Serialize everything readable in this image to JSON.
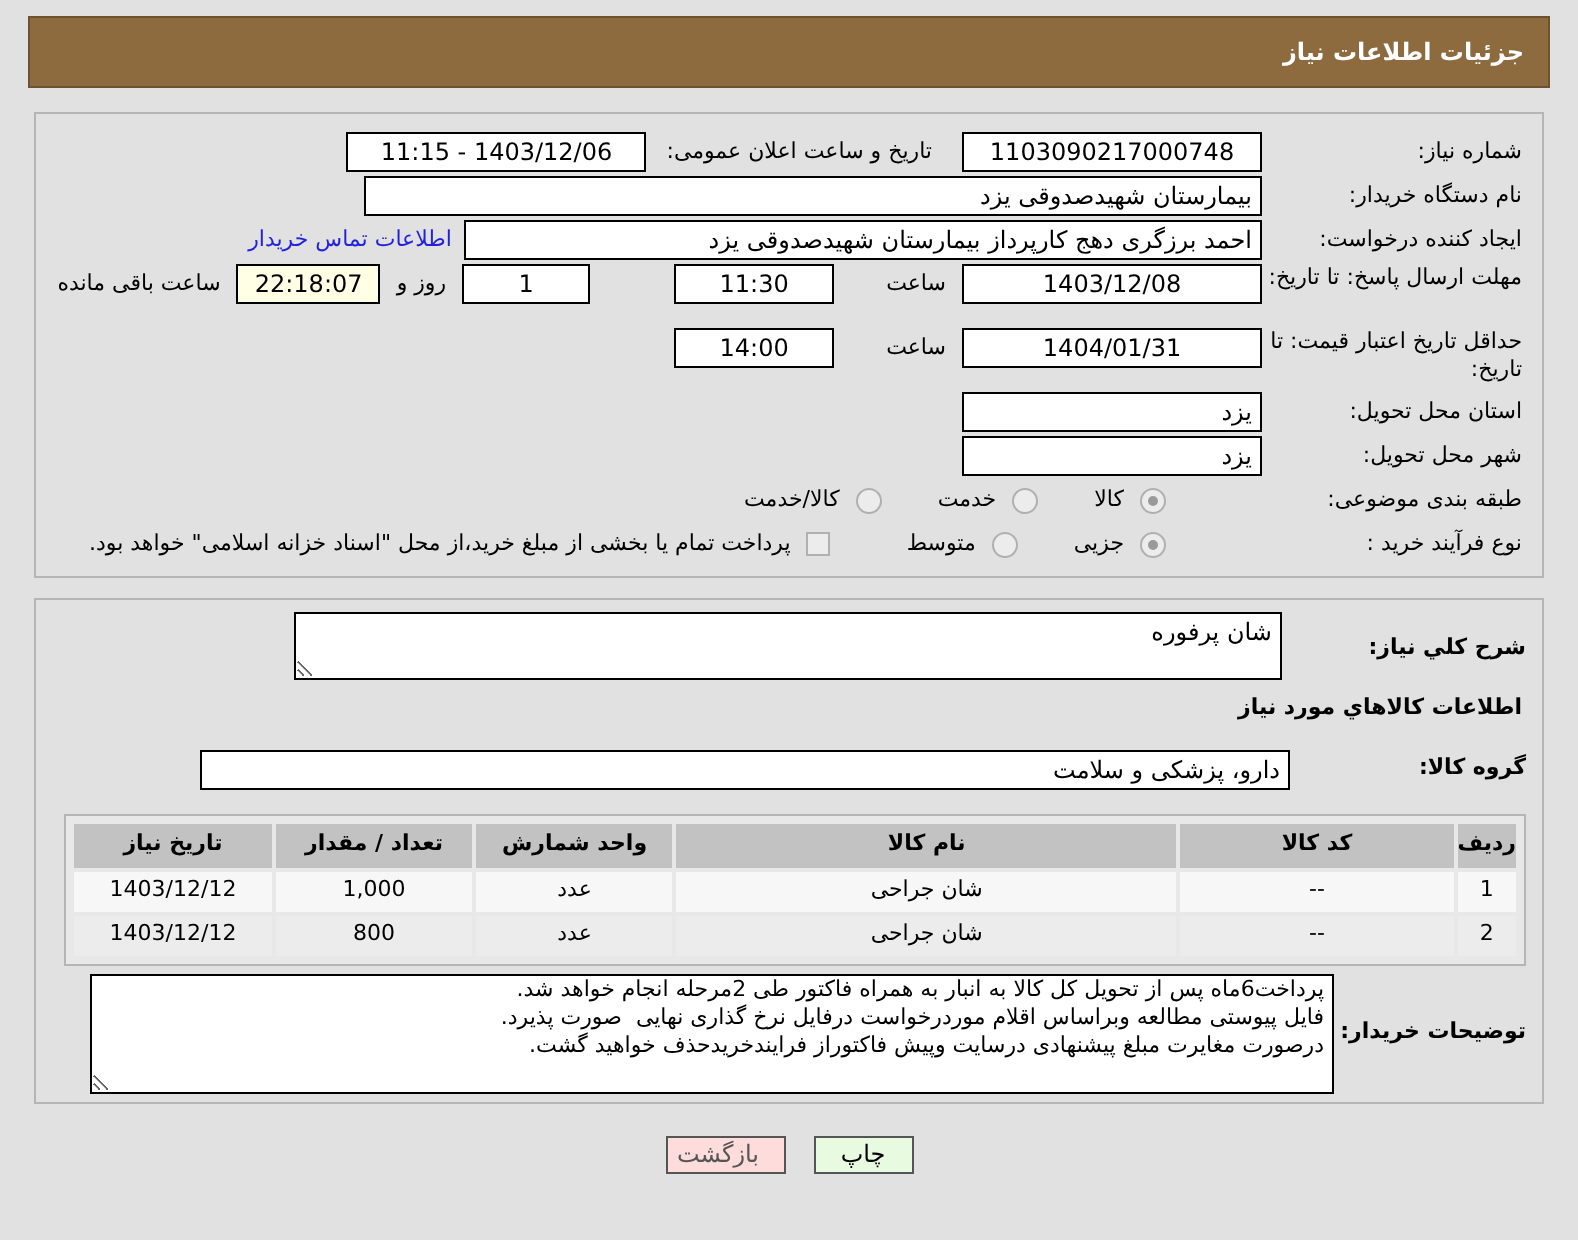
{
  "title": "جزئیات اطلاعات نیاز",
  "need_number": {
    "label": "شماره نیاز:",
    "value": "1103090217000748"
  },
  "announce": {
    "label": "تاریخ و ساعت اعلان عمومی:",
    "value": "1403/12/06 - 11:15"
  },
  "buyer": {
    "label": "نام دستگاه خریدار:",
    "value": "بیمارستان شهیدصدوقی یزد"
  },
  "creator": {
    "label": "ایجاد کننده درخواست:",
    "value": "احمد برزگری دهج کارپرداز بیمارستان شهیدصدوقی یزد",
    "link": "اطلاعات تماس خریدار"
  },
  "deadline": {
    "label": "مهلت ارسال پاسخ: تا تاریخ:",
    "date": "1403/12/08",
    "time_label": "ساعت",
    "time": "11:30",
    "days": "1",
    "days_label": "روز و",
    "remaining": "22:18:07",
    "remaining_label": "ساعت باقی مانده"
  },
  "validity": {
    "label": "حداقل تاریخ اعتبار قیمت: تا تاریخ:",
    "date": "1404/01/31",
    "time_label": "ساعت",
    "time": "14:00"
  },
  "province": {
    "label": "استان محل تحویل:",
    "value": "یزد"
  },
  "city": {
    "label": "شهر محل تحویل:",
    "value": "یزد"
  },
  "category": {
    "label": "طبقه بندی موضوعی:",
    "options": [
      {
        "label": "کالا",
        "selected": true
      },
      {
        "label": "خدمت",
        "selected": false
      },
      {
        "label": "کالا/خدمت",
        "selected": false
      }
    ]
  },
  "process": {
    "label": "نوع فرآیند خرید :",
    "options": [
      {
        "label": "جزیی",
        "selected": true
      },
      {
        "label": "متوسط",
        "selected": false
      }
    ],
    "treasury": {
      "label": "پرداخت تمام یا بخشی از مبلغ خرید،از محل \"اسناد خزانه اسلامی\" خواهد بود.",
      "checked": false
    }
  },
  "description": {
    "label": "شرح کلي نياز:",
    "value": "شان پرفوره"
  },
  "items_heading": "اطلاعات کالاهاي مورد نياز",
  "group": {
    "label": "گروه کالا:",
    "value": "دارو، پزشکی و سلامت"
  },
  "table": {
    "columns": [
      "ردیف",
      "کد کالا",
      "نام کالا",
      "واحد شمارش",
      "تعداد / مقدار",
      "تاریخ نیاز"
    ],
    "rows": [
      [
        "1",
        "--",
        "شان جراحی",
        "عدد",
        "1,000",
        "1403/12/12"
      ],
      [
        "2",
        "--",
        "شان جراحی",
        "عدد",
        "800",
        "1403/12/12"
      ]
    ]
  },
  "notes": {
    "label": "توضیحات خریدار:",
    "lines": [
      "پرداخت6ماه پس از تحویل کل کالا به انبار به همراه فاکتور طی 2مرحله انجام خواهد شد.",
      "فایل پیوستی مطالعه وبراساس اقلام موردرخواست درفایل نرخ گذاری نهایی  صورت پذیرد.",
      "درصورت مغایرت مبلغ پیشنهادی درسایت وپیش فاکتوراز فرایندخریدحذف خواهید گشت."
    ]
  },
  "buttons": [
    {
      "label": "چاپ",
      "kind": "print"
    },
    {
      "label": "بازگشت",
      "kind": "back"
    }
  ]
}
